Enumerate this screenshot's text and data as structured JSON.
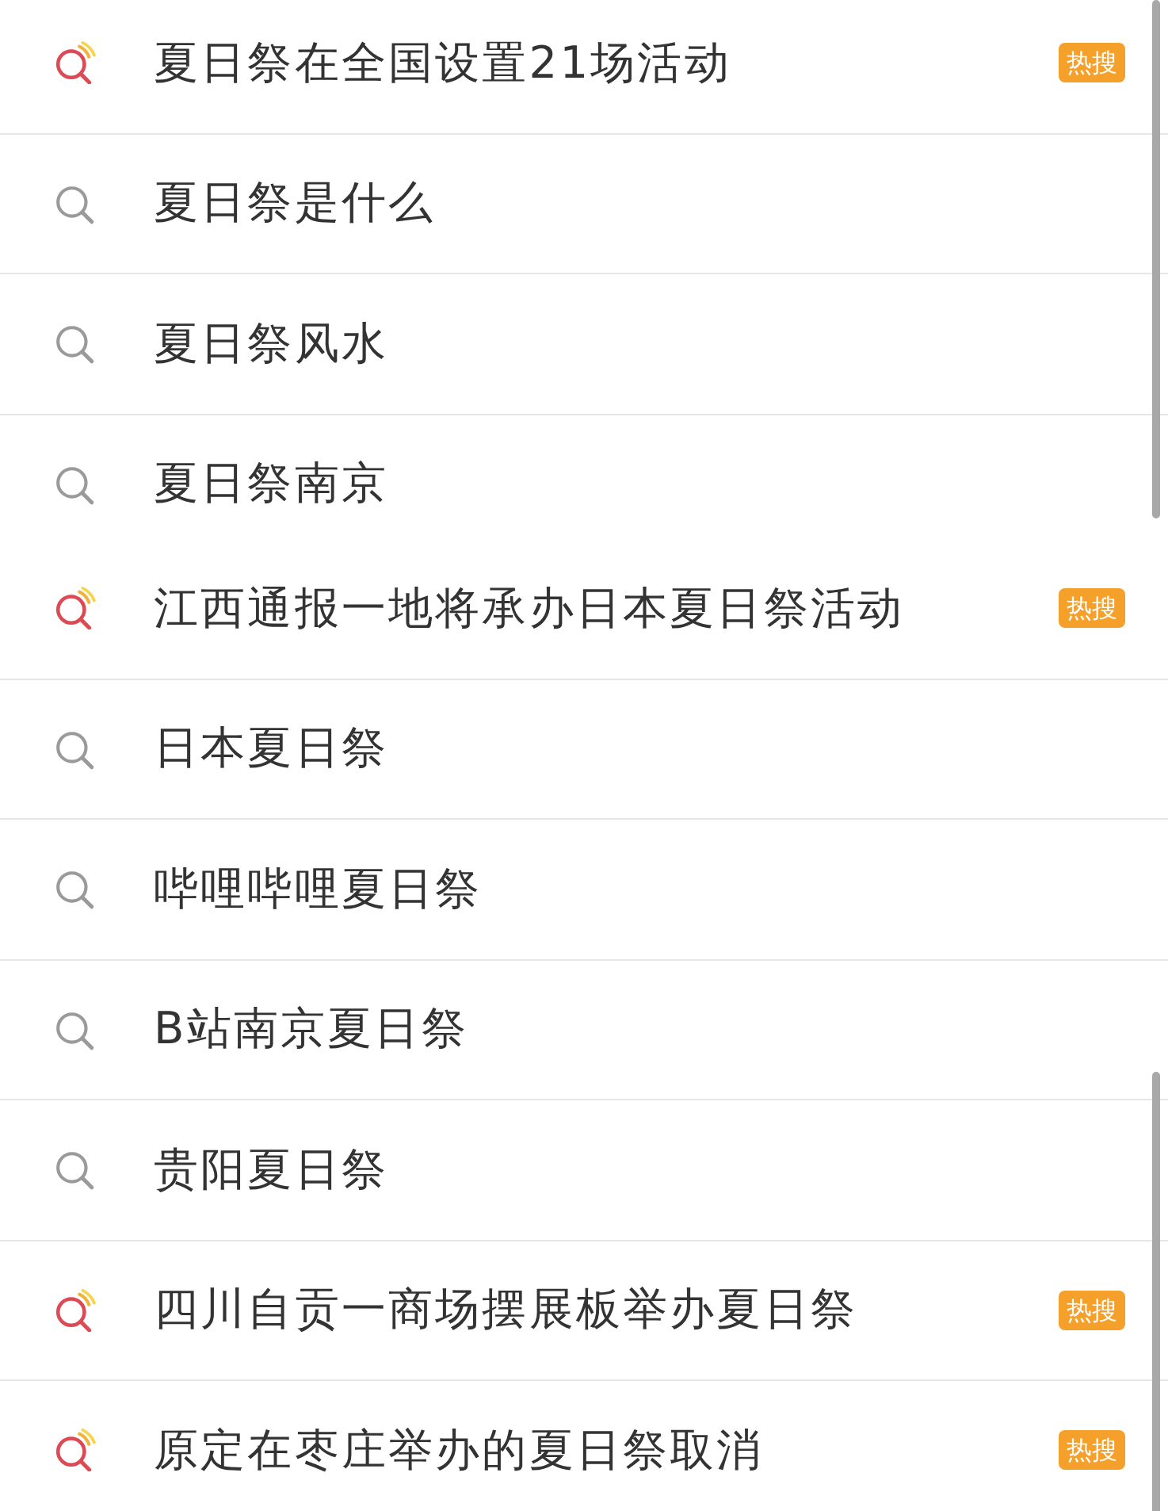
{
  "panels": [
    {
      "items": [
        {
          "kind": "hot",
          "text": "夏日祭在全国设置21场活动",
          "badge": "热搜"
        },
        {
          "kind": "plain",
          "text": "夏日祭是什么"
        },
        {
          "kind": "plain",
          "text": "夏日祭风水"
        },
        {
          "kind": "plain",
          "text": "夏日祭南京"
        }
      ]
    },
    {
      "items": [
        {
          "kind": "hot",
          "text": "江西通报一地将承办日本夏日祭活动",
          "badge": "热搜"
        },
        {
          "kind": "plain",
          "text": "日本夏日祭"
        },
        {
          "kind": "plain",
          "text": "哔哩哔哩夏日祭"
        },
        {
          "kind": "plain",
          "text": "B站南京夏日祭"
        },
        {
          "kind": "plain",
          "text": "贵阳夏日祭"
        },
        {
          "kind": "hot",
          "text": "四川自贡一商场摆展板举办夏日祭",
          "badge": "热搜"
        },
        {
          "kind": "hot",
          "text": "原定在枣庄举办的夏日祭取消",
          "badge": "热搜"
        }
      ]
    }
  ]
}
